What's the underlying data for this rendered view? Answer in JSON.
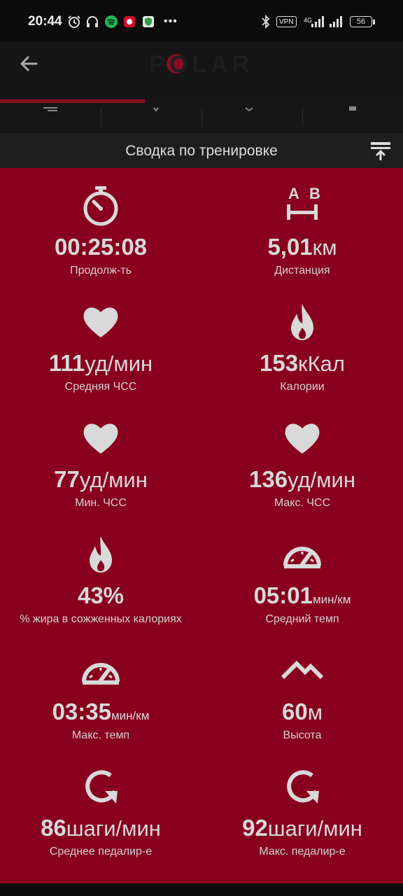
{
  "status": {
    "time": "20:44",
    "vpn": "VPN",
    "network": "4G",
    "battery": "56",
    "more": "•••"
  },
  "app": {
    "logo": "POLAR",
    "progress_fraction": 0.36
  },
  "summary": {
    "title": "Сводка по тренировке"
  },
  "metrics": [
    {
      "icon": "stopwatch-icon",
      "value": "00:25:08",
      "unit": "",
      "label": "Продолж-ть"
    },
    {
      "icon": "distance-icon",
      "value": "5,01",
      "unit": "км",
      "label": "Дистанция",
      "icon_text_a": "A",
      "icon_text_b": "B"
    },
    {
      "icon": "heart-icon",
      "value": "111",
      "unit": "уд/мин",
      "label": "Средняя ЧСС"
    },
    {
      "icon": "flame-icon",
      "value": "153",
      "unit": "кКал",
      "label": "Калории"
    },
    {
      "icon": "heart-icon",
      "value": "77",
      "unit": "уд/мин",
      "label": "Мин. ЧСС"
    },
    {
      "icon": "heart-icon",
      "value": "136",
      "unit": "уд/мин",
      "label": "Макс. ЧСС"
    },
    {
      "icon": "flame-icon",
      "value": "43%",
      "unit": "",
      "label": "% жира в сожженных калориях"
    },
    {
      "icon": "speedometer-icon",
      "value": "05:01",
      "unit": "мин/км",
      "label": "Средний темп"
    },
    {
      "icon": "speedometer-icon",
      "value": "03:35",
      "unit": "мин/км",
      "label": "Макс. темп"
    },
    {
      "icon": "mountain-icon",
      "value": "60",
      "unit": "м",
      "label": "Высота"
    },
    {
      "icon": "cadence-icon",
      "value": "86",
      "unit": "шаги/мин",
      "label": "Среднее педалир-е"
    },
    {
      "icon": "cadence-icon",
      "value": "92",
      "unit": "шаги/мин",
      "label": "Макс. педалир-е"
    }
  ]
}
